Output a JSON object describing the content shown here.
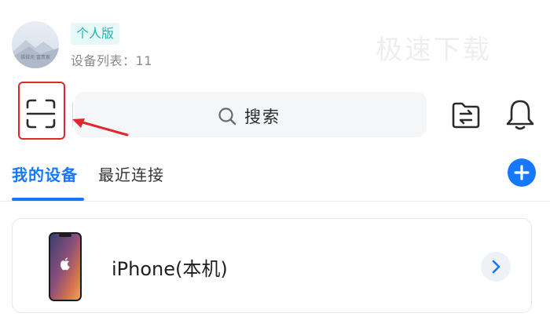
{
  "profile": {
    "avatar_caption": "福禄天·富贵家",
    "plan_badge": "个人版",
    "device_count_label": "设备列表：",
    "device_count_value": "11"
  },
  "watermark": "极速下载",
  "toolbar": {
    "search_placeholder": "搜索",
    "icons": {
      "scan": "scan-icon",
      "search": "search-icon",
      "file_transfer": "file-transfer-icon",
      "notifications": "bell-icon",
      "add": "plus-icon",
      "chevron": "chevron-right-icon"
    }
  },
  "tabs": [
    {
      "label": "我的设备",
      "active": true
    },
    {
      "label": "最近连接",
      "active": false
    }
  ],
  "devices": [
    {
      "name": "iPhone(本机)"
    }
  ],
  "colors": {
    "accent": "#1677ff",
    "badge_text": "#1fb8b0",
    "badge_bg": "#e6f8f7",
    "highlight": "#e0272e",
    "search_bg": "#f4f6f8"
  }
}
